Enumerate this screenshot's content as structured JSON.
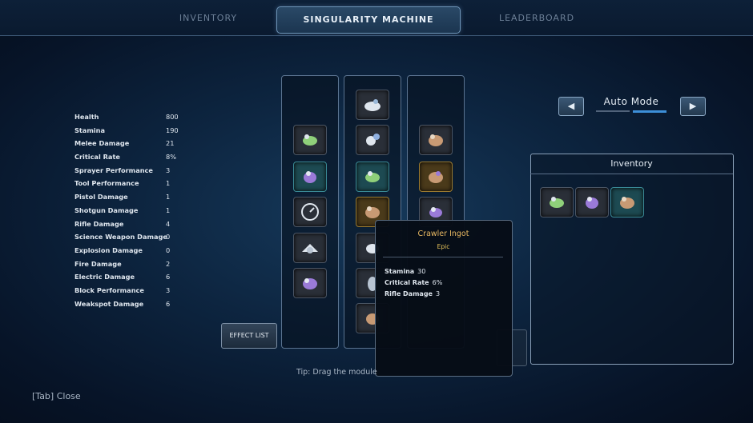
{
  "nav": {
    "tabs": [
      {
        "label": "INVENTORY",
        "active": false
      },
      {
        "label": "SINGULARITY MACHINE",
        "active": true
      },
      {
        "label": "LEADERBOARD",
        "active": false
      }
    ]
  },
  "stats": [
    {
      "label": "Health",
      "value": "800"
    },
    {
      "label": "Stamina",
      "value": "190"
    },
    {
      "label": "Melee Damage",
      "value": "21"
    },
    {
      "label": "Critical Rate",
      "value": "8%"
    },
    {
      "label": "Sprayer Performance",
      "value": "3"
    },
    {
      "label": "Tool Performance",
      "value": "1"
    },
    {
      "label": "Pistol Damage",
      "value": "1"
    },
    {
      "label": "Shotgun Damage",
      "value": "1"
    },
    {
      "label": "Rifle Damage",
      "value": "4"
    },
    {
      "label": "Science Weapon Damage",
      "value": "0"
    },
    {
      "label": "Explosion Damage",
      "value": "0"
    },
    {
      "label": "Fire Damage",
      "value": "2"
    },
    {
      "label": "Electric Damage",
      "value": "6"
    },
    {
      "label": "Block Performance",
      "value": "3"
    },
    {
      "label": "Weakspot Damage",
      "value": "6"
    }
  ],
  "auto_mode": {
    "label": "Auto Mode",
    "prev_icon": "left-arrow-icon",
    "next_icon": "right-arrow-icon",
    "prev_glyph": "◀",
    "next_glyph": "▶"
  },
  "inventory": {
    "title": "Inventory"
  },
  "effect_list": {
    "label": "EFFECT LIST"
  },
  "tooltip": {
    "name": "Crawler Ingot",
    "rarity": "Epic",
    "stats": [
      {
        "label": "Stamina",
        "value": "30"
      },
      {
        "label": "Critical Rate",
        "value": "6%"
      },
      {
        "label": "Rifle Damage",
        "value": "3"
      }
    ]
  },
  "tip": "Tip: Drag the module",
  "close_hint": "[Tab] Close",
  "colors": {
    "accent": "#3d8fd8",
    "epic_gold": "#e8b862",
    "background": "#0d2540"
  }
}
